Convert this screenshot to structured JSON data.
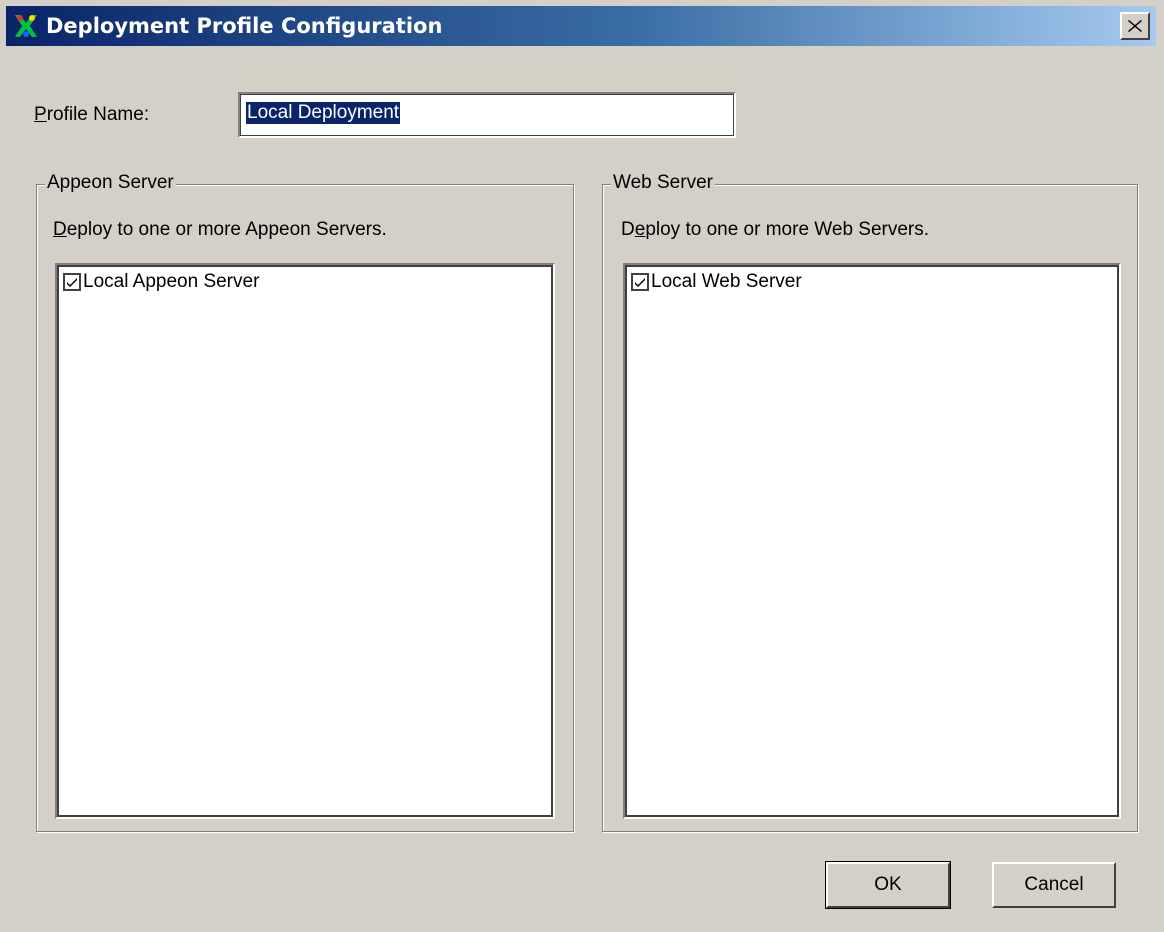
{
  "window": {
    "title": "Deployment Profile Configuration",
    "close_label": "×"
  },
  "profile": {
    "label_prefix": "P",
    "label_rest": "rofile Name:",
    "value": "Local Deployment"
  },
  "appeon_group": {
    "title": "Appeon Server",
    "description_prefix": "D",
    "description_rest": "eploy to one or more Appeon Servers.",
    "items": [
      {
        "label": "Local Appeon Server",
        "checked": true
      }
    ]
  },
  "web_group": {
    "title": "Web Server",
    "description_prefix": "D",
    "description_mnemonic": "e",
    "description_rest": "ploy to one or more Web Servers.",
    "items": [
      {
        "label": "Local Web Server",
        "checked": true
      }
    ]
  },
  "buttons": {
    "ok": "OK",
    "cancel": "Cancel"
  },
  "icons": {
    "app": "appeon-logo-icon",
    "close": "close-icon",
    "check": "checkmark-icon"
  }
}
